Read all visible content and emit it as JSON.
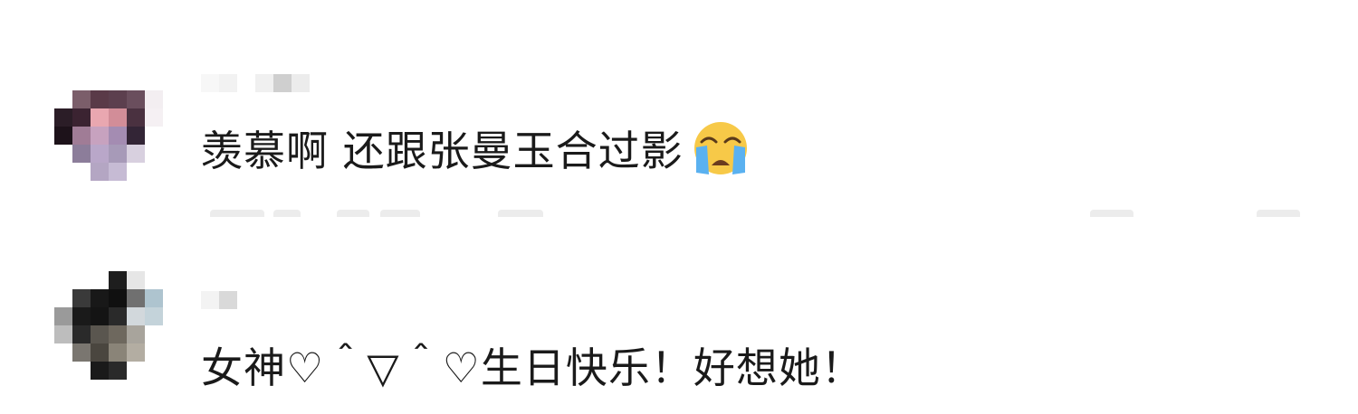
{
  "comments": [
    {
      "text": "羡慕啊 还跟张曼玉合过影",
      "emoji_icon": "loudly-crying-face-icon",
      "avatar_pixels": [
        [
          "#ffffff",
          "#ffffff",
          "#ffffff",
          "#ffffff",
          "#ffffff",
          "#ffffff"
        ],
        [
          "#ffffff",
          "#7b5e6a",
          "#5a3a48",
          "#5c3f4e",
          "#6a4e5d",
          "#f3eef1"
        ],
        [
          "#2b1d27",
          "#3b2331",
          "#e9a7b0",
          "#d28d98",
          "#4a3140",
          "#f5f0f3"
        ],
        [
          "#1d121a",
          "#a07c96",
          "#c7a2bf",
          "#a48cb2",
          "#332536",
          "#ffffff"
        ],
        [
          "#ffffff",
          "#8c7d9a",
          "#b9a7c9",
          "#a79ab8",
          "#d8d0df",
          "#ffffff"
        ],
        [
          "#ffffff",
          "#ffffff",
          "#b4a6c3",
          "#c6bbd4",
          "#ffffff",
          "#ffffff"
        ]
      ],
      "name_blocks": [
        "#f7f7f7",
        "#f2f2f2",
        "#ffffff",
        "#f0f0f0",
        "#cfcfcf",
        "#ececec"
      ]
    },
    {
      "text": "女神♡＾▽＾♡生日快乐！好想她！",
      "avatar_pixels": [
        [
          "#ffffff",
          "#ffffff",
          "#ffffff",
          "#1e1e1e",
          "#e6e6e6",
          "#ffffff"
        ],
        [
          "#ffffff",
          "#3a3a3a",
          "#181818",
          "#101010",
          "#707070",
          "#aec4cf"
        ],
        [
          "#9a9a9a",
          "#1a1a1a",
          "#141414",
          "#2a2a2a",
          "#d2d8dc",
          "#c4d3da"
        ],
        [
          "#bdbdbd",
          "#2a2a2a",
          "#5a564f",
          "#6e685e",
          "#a8a49c",
          "#ffffff"
        ],
        [
          "#ffffff",
          "#7a7670",
          "#4a463f",
          "#8a8478",
          "#b3ada2",
          "#ffffff"
        ],
        [
          "#ffffff",
          "#ffffff",
          "#1a1a1a",
          "#2a2a2a",
          "#ffffff",
          "#ffffff"
        ]
      ],
      "name_blocks": [
        "#f3f3f3",
        "#d9d9d9"
      ]
    }
  ],
  "colors": {
    "text": "#1a1a1a",
    "background": "#ffffff",
    "emoji_face": "#f7c948",
    "emoji_tears": "#5ab1f0"
  }
}
